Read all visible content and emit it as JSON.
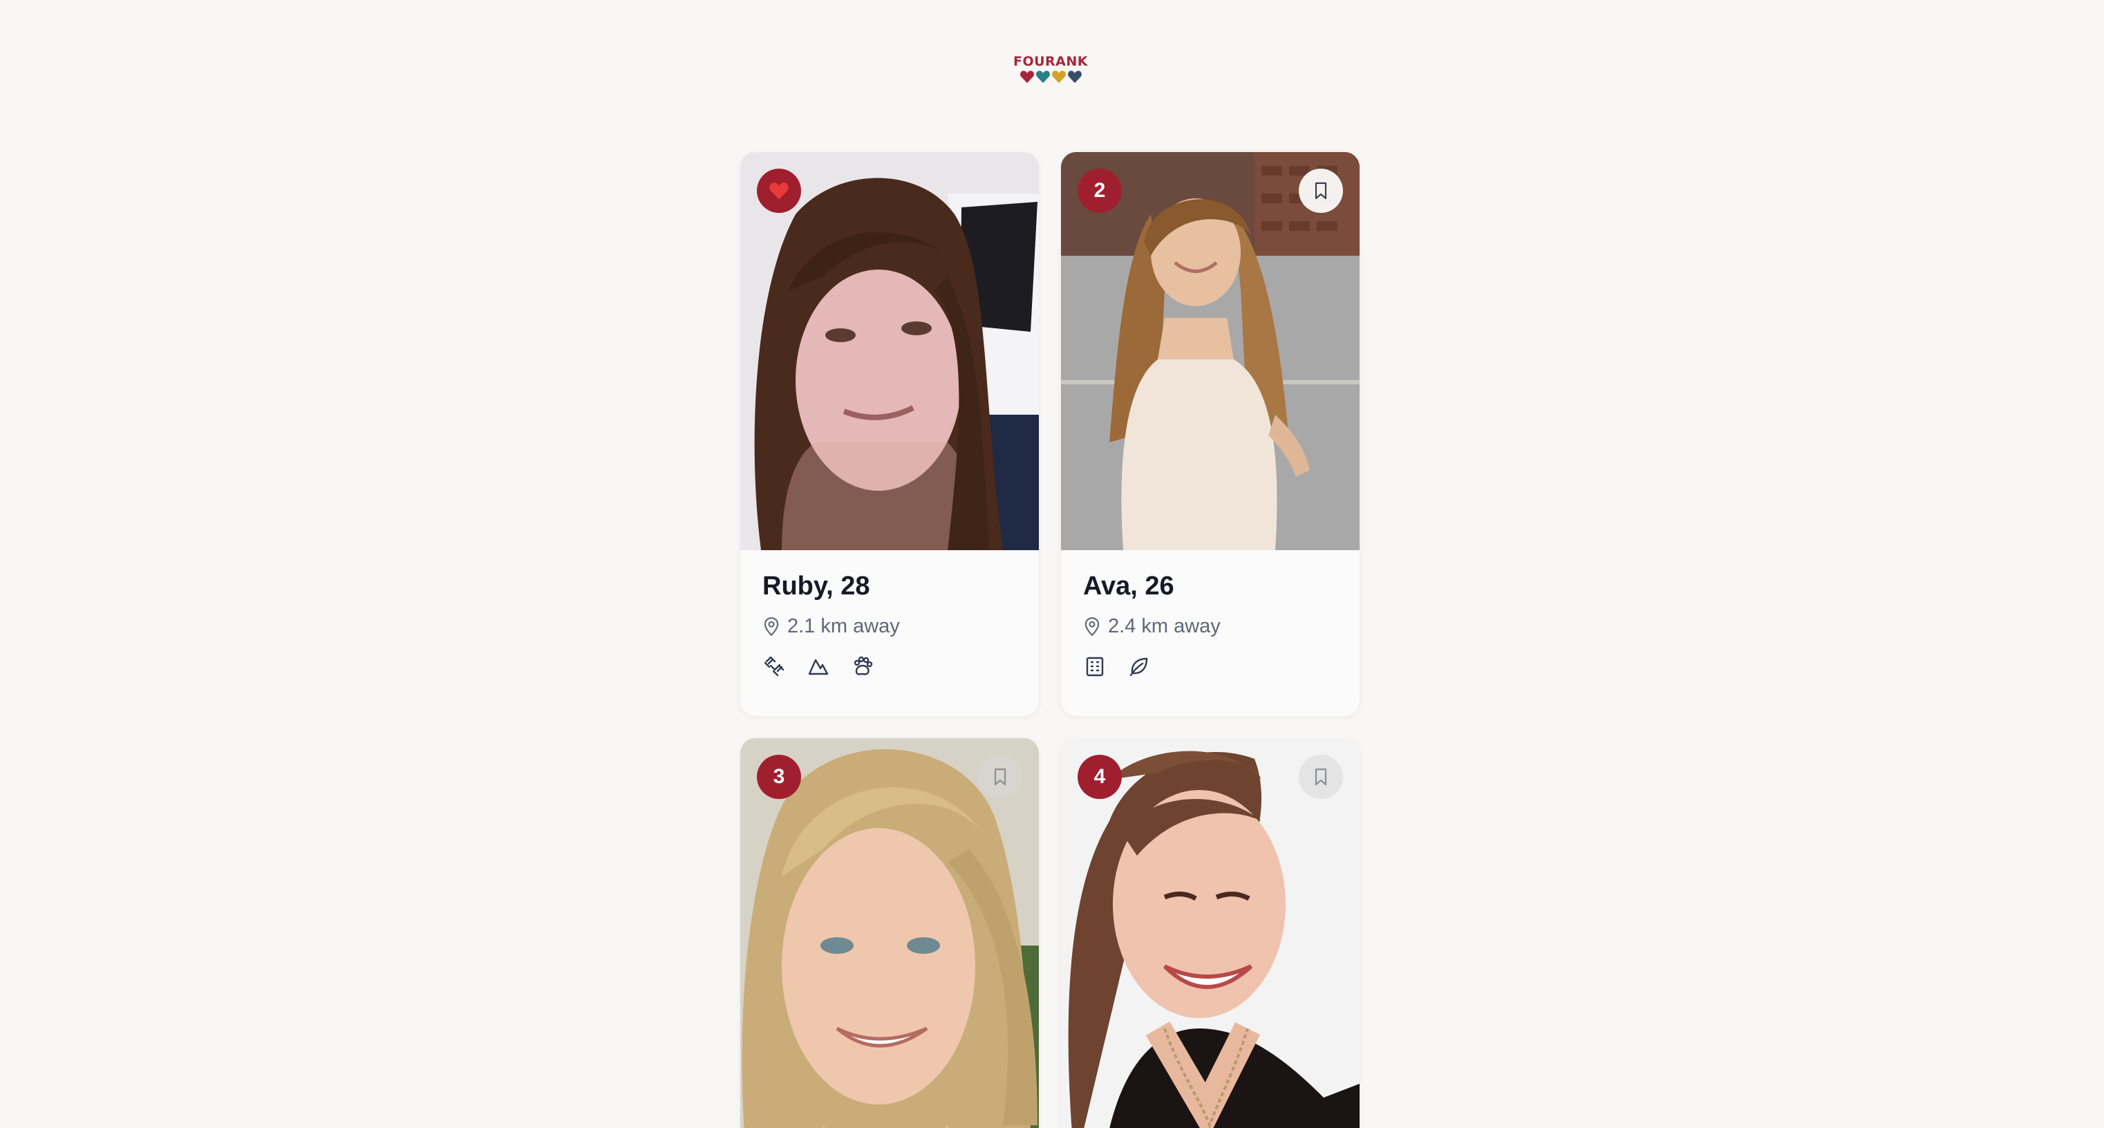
{
  "app": {
    "logo_text": "FOURANK",
    "logo_heart_colors": [
      "#a8253a",
      "#2b7f86",
      "#d6a02a",
      "#3c4d6b"
    ]
  },
  "colors": {
    "accent": "#a01f2e",
    "text_primary": "#151a26",
    "text_secondary": "#5e6678",
    "background": "#f8f7f5"
  },
  "profiles": [
    {
      "badge": "",
      "badge_icon": "heart-icon",
      "name_age": "Ruby, 28",
      "distance": "2.1 km away",
      "bookmark": false,
      "interest_icons": [
        "dumbbell-icon",
        "mountain-icon",
        "paw-icon"
      ]
    },
    {
      "badge": "2",
      "name_age": "Ava, 26",
      "distance": "2.4 km away",
      "bookmark": true,
      "interest_icons": [
        "building-icon",
        "leaf-icon"
      ]
    },
    {
      "badge": "3",
      "name_age": "",
      "distance": "",
      "bookmark": true,
      "interest_icons": []
    },
    {
      "badge": "4",
      "name_age": "",
      "distance": "",
      "bookmark": true,
      "interest_icons": []
    }
  ]
}
